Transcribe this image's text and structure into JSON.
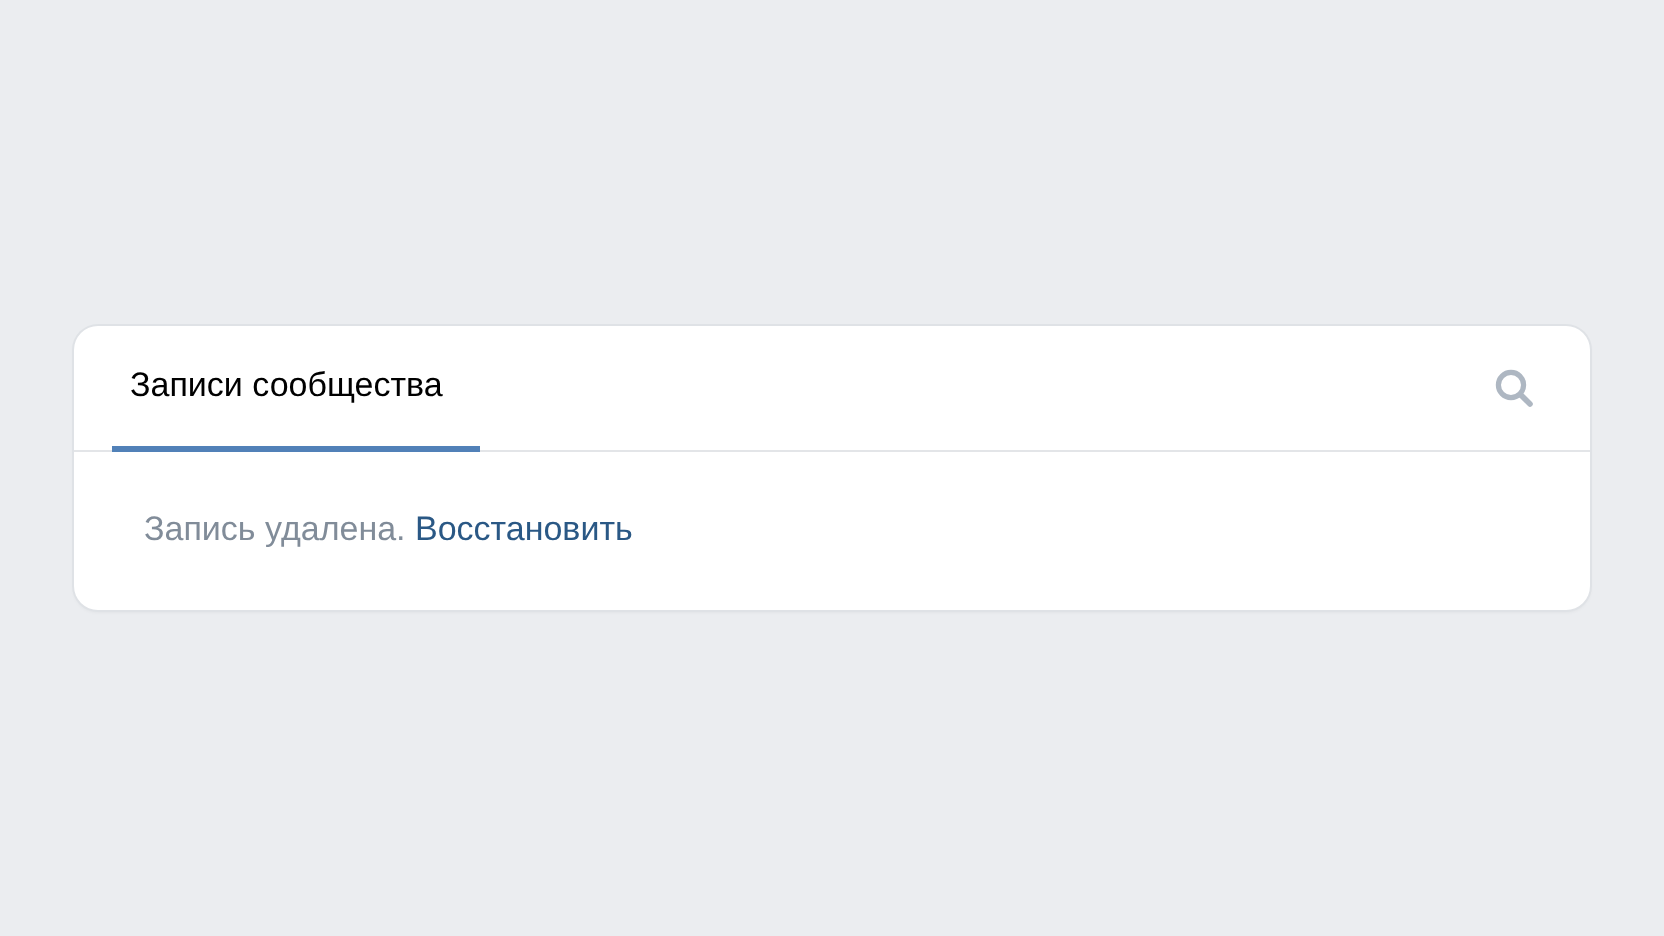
{
  "tabs": [
    {
      "label": "Записи сообщества",
      "selected": true
    }
  ],
  "search": {
    "kind": "icon"
  },
  "notice": {
    "text": "Запись удалена.",
    "link": "Восстановить"
  }
}
